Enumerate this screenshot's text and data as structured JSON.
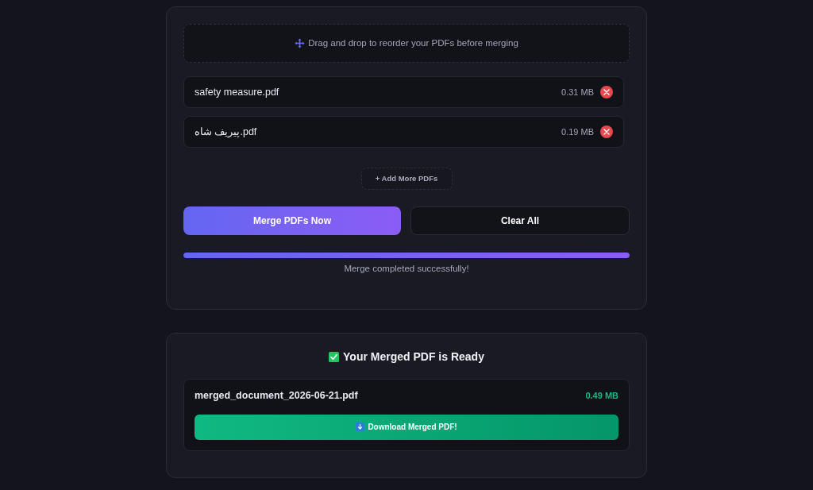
{
  "dropzone": {
    "hint": "Drag and drop to reorder your PDFs before merging"
  },
  "files": [
    {
      "name": "safety measure.pdf",
      "size": "0.31 MB"
    },
    {
      "name": "پیریف شاه.pdf",
      "size": "0.19 MB"
    }
  ],
  "add_more_button": "+ Add More PDFs",
  "actions": [
    {
      "label": "Merge PDFs Now",
      "kind": "primary"
    },
    {
      "label": "Clear All",
      "kind": "secondary"
    }
  ],
  "progress": {
    "level": 1,
    "message": "Merge completed successfully!"
  },
  "result": {
    "title": "Your Merged PDF is Ready",
    "file_name": "merged_document_2026-06-21.pdf",
    "size": "0.49 MB",
    "download_button": "Download Merged PDF!"
  }
}
